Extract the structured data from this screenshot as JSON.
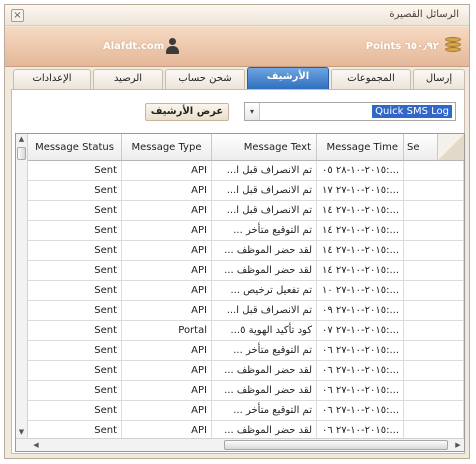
{
  "window": {
    "title": "الرسائل القصيرة",
    "close_glyph": "×"
  },
  "header": {
    "username": "Alafdt.com",
    "points": "Points ٦٥٠٫٩٢",
    "user_icon": "user-icon",
    "coins_icon": "coins-icon"
  },
  "tabs": [
    {
      "label": "إرسال"
    },
    {
      "label": "المجموعات"
    },
    {
      "label": "الأرشيف",
      "active": true
    },
    {
      "label": "شحن حساب"
    },
    {
      "label": "الرصيد"
    },
    {
      "label": "الإعدادات"
    }
  ],
  "archive": {
    "show_button_label": "عرض الأرشيف",
    "selected_option": "Quick SMS Log",
    "dropdown_glyph": "▾"
  },
  "table": {
    "columns": [
      {
        "label": "Message Status"
      },
      {
        "label": "Message Type"
      },
      {
        "label": "Message Text"
      },
      {
        "label": "Message Time"
      },
      {
        "label": "Se"
      }
    ],
    "rows": [
      {
        "status": "Sent",
        "type": "API",
        "text": "تم الانصراف قبل ا...",
        "time": "٢٠١٥-١٠-٢٨ ٠٥:..."
      },
      {
        "status": "Sent",
        "type": "API",
        "text": "تم الانصراف قبل ا...",
        "time": "٢٠١٥-١٠-٢٧ ١٧:..."
      },
      {
        "status": "Sent",
        "type": "API",
        "text": "تم الانصراف قبل ا...",
        "time": "٢٠١٥-١٠-٢٧ ١٤:..."
      },
      {
        "status": "Sent",
        "type": "API",
        "text": "تم التوقيع متأخر ...",
        "time": "٢٠١٥-١٠-٢٧ ١٤:..."
      },
      {
        "status": "Sent",
        "type": "API",
        "text": "لقد حضر الموظف ...",
        "time": "٢٠١٥-١٠-٢٧ ١٤:..."
      },
      {
        "status": "Sent",
        "type": "API",
        "text": "لقد حضر الموظف ...",
        "time": "٢٠١٥-١٠-٢٧ ١٤:..."
      },
      {
        "status": "Sent",
        "type": "API",
        "text": "تم تفعيل ترخيص ...",
        "time": "٢٠١٥-١٠-٢٧ ١٠:..."
      },
      {
        "status": "Sent",
        "type": "API",
        "text": "تم الانصراف قبل ا...",
        "time": "٢٠١٥-١٠-٢٧ ٠٩:..."
      },
      {
        "status": "Sent",
        "type": "Portal",
        "text": "كود تأكيد الهوية ٥...",
        "time": "٢٠١٥-١٠-٢٧ ٠٧:..."
      },
      {
        "status": "Sent",
        "type": "API",
        "text": "تم التوقيع متأخر ...",
        "time": "٢٠١٥-١٠-٢٧ ٠٦:..."
      },
      {
        "status": "Sent",
        "type": "API",
        "text": "لقد حضر الموظف ...",
        "time": "٢٠١٥-١٠-٢٧ ٠٦:..."
      },
      {
        "status": "Sent",
        "type": "API",
        "text": "لقد حضر الموظف ...",
        "time": "٢٠١٥-١٠-٢٧ ٠٦:..."
      },
      {
        "status": "Sent",
        "type": "API",
        "text": "تم التوقيع متأخر ...",
        "time": "٢٠١٥-١٠-٢٧ ٠٦:..."
      },
      {
        "status": "Sent",
        "type": "API",
        "text": "لقد حضر الموظف ...",
        "time": "٢٠١٥-١٠-٢٧ ٠٦:..."
      }
    ]
  },
  "scroll": {
    "up": "▲",
    "down": "▼",
    "left": "◀",
    "right": "▶"
  },
  "colors": {
    "accent": "#2f6fc0",
    "header_bg": "#e9c2a5",
    "selection": "#3267c8"
  }
}
